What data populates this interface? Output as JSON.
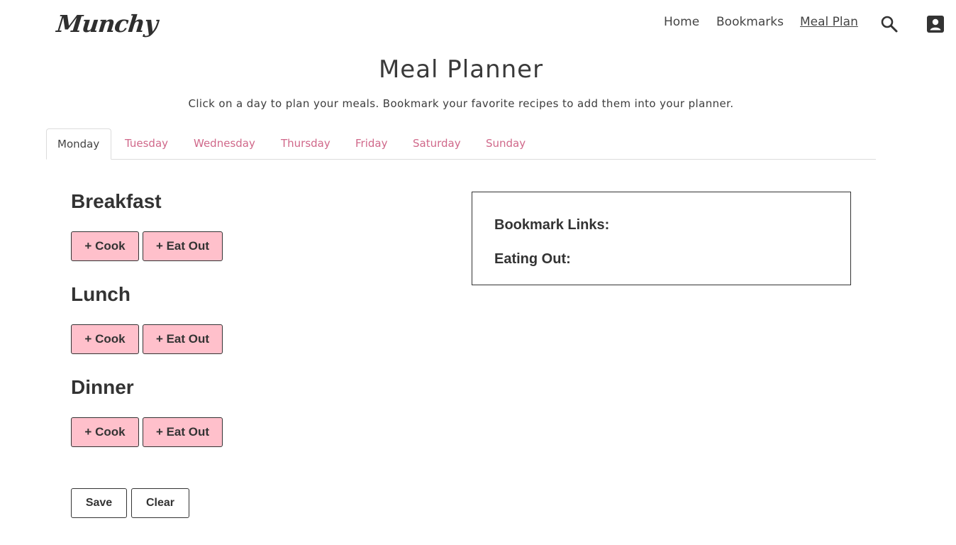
{
  "brand": {
    "logo_text": "Munchy"
  },
  "nav": {
    "links": [
      {
        "label": "Home"
      },
      {
        "label": "Bookmarks"
      },
      {
        "label": "Meal Plan",
        "active": true
      }
    ],
    "icons": [
      "search-icon",
      "account-icon"
    ]
  },
  "page": {
    "title": "Meal Planner",
    "subtitle": "Click on a day to plan your meals. Bookmark your favorite recipes to add them into your planner."
  },
  "tabs": [
    {
      "label": "Monday",
      "active": true
    },
    {
      "label": "Tuesday"
    },
    {
      "label": "Wednesday"
    },
    {
      "label": "Thursday"
    },
    {
      "label": "Friday"
    },
    {
      "label": "Saturday"
    },
    {
      "label": "Sunday"
    }
  ],
  "meals": [
    {
      "heading": "Breakfast",
      "cook_label": "+ Cook",
      "eat_out_label": "+ Eat Out"
    },
    {
      "heading": "Lunch",
      "cook_label": "+ Cook",
      "eat_out_label": "+ Eat Out"
    },
    {
      "heading": "Dinner",
      "cook_label": "+ Cook",
      "eat_out_label": "+ Eat Out"
    }
  ],
  "side_panel": {
    "bookmark_links_label": "Bookmark Links:",
    "eating_out_label": "Eating Out:"
  },
  "actions": {
    "save_label": "Save",
    "clear_label": "Clear"
  },
  "colors": {
    "accent_pink": "#ffc0cb",
    "tab_link": "#d0688a",
    "text": "#333333"
  }
}
